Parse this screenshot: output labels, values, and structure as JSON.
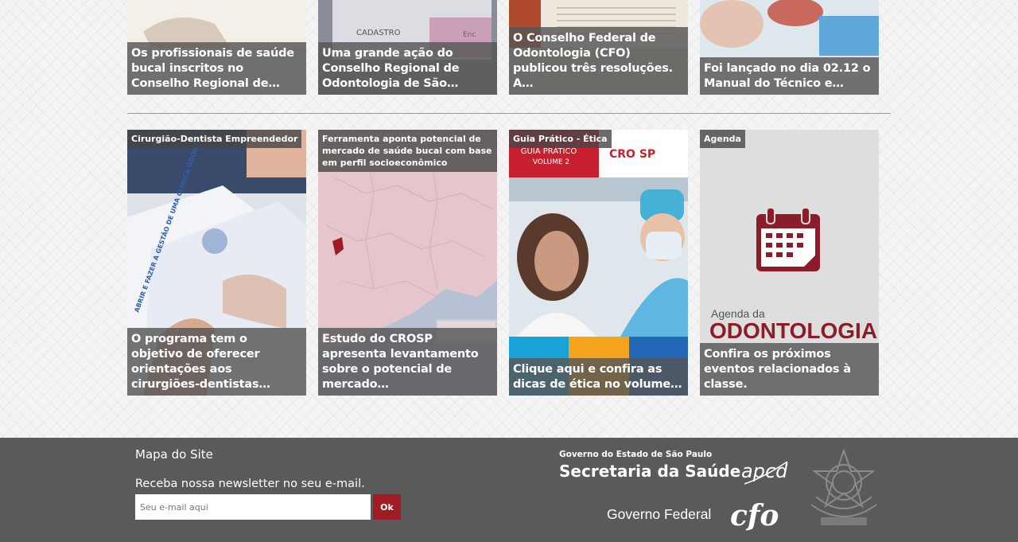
{
  "top_cards": [
    {
      "caption": "Os profissionais de saúde bucal inscritos no Conselho Regional de…"
    },
    {
      "caption": "Uma grande ação do Conselho Regional de Odontologia de São…",
      "image_text_1": "CADASTRO",
      "image_text_2": "Enc"
    },
    {
      "caption": "O Conselho Federal de Odontologia (CFO) publicou três resoluções. A…"
    },
    {
      "caption": "Foi lançado no dia 02.12 o Manual do Técnico e…"
    }
  ],
  "cards": [
    {
      "tag": "Cirurgião-Dentista Empreendedor",
      "caption": "O programa tem o objetivo de oferecer orientações aos cirurgiões-dentistas…",
      "image_text": "ABRIR E FAZER A GESTÃO DE UMA CLÍNICA ODONTOLÓGICA"
    },
    {
      "tag": "Ferramenta aponta potencial de mercado de saúde bucal com base em perfil socioeconômico",
      "caption": "Estudo do CROSP apresenta levantamento sobre o potencial de mercado…"
    },
    {
      "tag": "Guia Prático - Ética",
      "caption": "Clique aqui e confira as dicas de ética no volume…",
      "image_text_title": "GUIA PRÁTICO",
      "image_text_volume": "VOLUME 2",
      "logo_text": "CRO SP"
    },
    {
      "tag": "Agenda",
      "caption": "Confira os próximos eventos relacionados à classe.",
      "image_text_small": "Agenda da",
      "image_text_big": "ODONTOLOGIA"
    }
  ],
  "footer": {
    "site_map": "Mapa do Site",
    "newsletter_label": "Receba nossa newsletter no seu e-mail.",
    "email_placeholder": "Seu e-mail aqui",
    "ok_label": "Ok",
    "gov_state_small": "Governo do Estado de São Paulo",
    "gov_state_big": "Secretaria da Saúde",
    "apcd": "apcd",
    "gov_federal": "Governo Federal",
    "cfo": "cfo"
  },
  "colors": {
    "accent": "#a01c25",
    "footer_bg": "#5a5a5a",
    "caption_bg": "#555555"
  }
}
